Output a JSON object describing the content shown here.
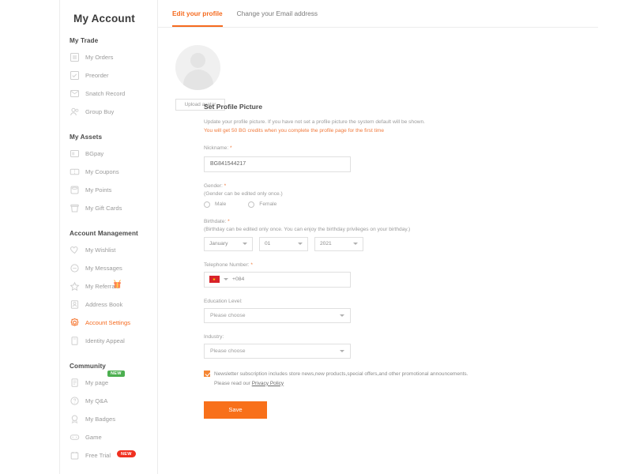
{
  "sidebar": {
    "title": "My Account",
    "sections": [
      {
        "title": "My Trade",
        "items": [
          {
            "label": "My Orders",
            "icon": "orders-icon",
            "active": false
          },
          {
            "label": "Preorder",
            "icon": "preorder-icon",
            "active": false
          },
          {
            "label": "Snatch Record",
            "icon": "snatch-record-icon",
            "active": false
          },
          {
            "label": "Group Buy",
            "icon": "group-buy-icon",
            "active": false
          }
        ]
      },
      {
        "title": "My Assets",
        "items": [
          {
            "label": "BGpay",
            "icon": "bgpay-icon",
            "active": false
          },
          {
            "label": "My Coupons",
            "icon": "coupons-icon",
            "active": false
          },
          {
            "label": "My Points",
            "icon": "points-icon",
            "active": false
          },
          {
            "label": "My Gift Cards",
            "icon": "gift-card-icon",
            "active": false
          }
        ]
      },
      {
        "title": "Account Management",
        "items": [
          {
            "label": "My Wishlist",
            "icon": "heart-icon",
            "active": false
          },
          {
            "label": "My Messages",
            "icon": "message-icon",
            "active": false
          },
          {
            "label": "My Referrals",
            "icon": "star-icon",
            "active": false,
            "decoration": "gift-icon"
          },
          {
            "label": "Address Book",
            "icon": "address-book-icon",
            "active": false
          },
          {
            "label": "Account Settings",
            "icon": "settings-gear-icon",
            "active": true
          },
          {
            "label": "Identity Appeal",
            "icon": "identity-icon",
            "active": false
          }
        ]
      },
      {
        "title": "Community",
        "items": [
          {
            "label": "My page",
            "icon": "page-icon",
            "active": false,
            "badge": "NEW",
            "badge_color": "#4caf50"
          },
          {
            "label": "My Q&A",
            "icon": "question-icon",
            "active": false
          },
          {
            "label": "My Badges",
            "icon": "badge-icon",
            "active": false
          },
          {
            "label": "Game",
            "icon": "game-icon",
            "active": false
          },
          {
            "label": "Free Trial",
            "icon": "free-trial-icon",
            "active": false,
            "badge": "NEW",
            "badge_color": "#f03020"
          }
        ]
      }
    ]
  },
  "tabs": [
    {
      "label": "Edit your profile",
      "active": true
    },
    {
      "label": "Change your Email address",
      "active": false
    }
  ],
  "profile": {
    "upload_button": "Upload avatar",
    "section_heading": "Set Profile Picture",
    "description": "Update your profile picture. If you have not set a profile picture the system default will be shown.",
    "promo": "You will get 50 BG credits when you complete the profile page for the first time",
    "nickname": {
      "label": "Nickname:",
      "required": "*",
      "value": "BG841544217"
    },
    "gender": {
      "label": "Gender:",
      "required": "*",
      "note": "(Gender can be edited only once.)",
      "options": [
        {
          "label": "Male",
          "selected": false
        },
        {
          "label": "Female",
          "selected": false
        }
      ]
    },
    "birthdate": {
      "label": "Birthdate:",
      "required": "*",
      "note": "(Birthday can be edited only once. You can enjoy the birthday privileges on your birthday.)",
      "month": "January",
      "day": "01",
      "year": "2021"
    },
    "telephone": {
      "label": "Telephone Number:",
      "required": "*",
      "country_flag": "vietnam-flag",
      "country_code": "+084",
      "value": ""
    },
    "education": {
      "label": "Education Level:",
      "value": "Please choose"
    },
    "industry": {
      "label": "Industry:",
      "value": "Please choose"
    },
    "newsletter": {
      "checked": true,
      "text": "Newsletter subscription includes store news,new products,special offers,and other promotional announcements.",
      "text2": "Please read our ",
      "link": "Privacy Policy"
    },
    "save_button": "Save"
  },
  "colors": {
    "accent": "#f56a1e",
    "save_button": "#f8701a",
    "checkbox": "#f58634",
    "badge_green": "#4caf50",
    "badge_red": "#f03020"
  }
}
